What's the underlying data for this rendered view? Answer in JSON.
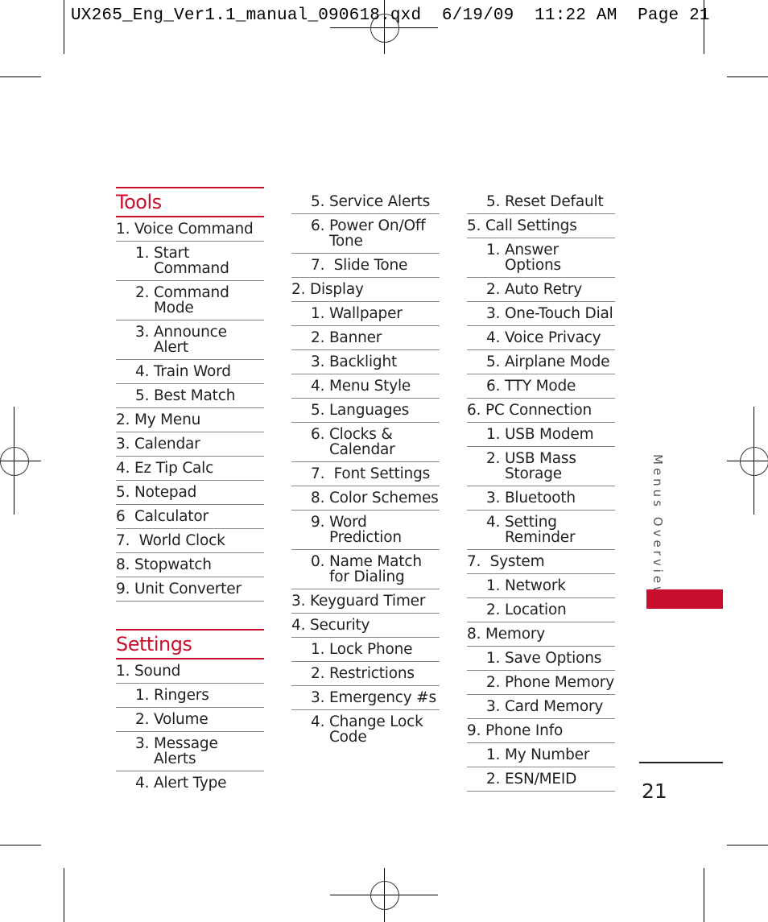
{
  "slug_line": "UX265_Eng_Ver1.1_manual_090618.qxd  6/19/09  11:22 AM  Page 21",
  "colors": {
    "accent": "#c8102e",
    "text": "#231f20",
    "rule": "#888888"
  },
  "column1": {
    "tools": {
      "title": "Tools",
      "items": [
        {
          "n": "1. ",
          "t": "Voice Command",
          "level": 0
        },
        {
          "n": "1. ",
          "t": "Start Command",
          "level": 1
        },
        {
          "n": "2. ",
          "t": "Command Mode",
          "level": 1
        },
        {
          "n": "3. ",
          "t": "Announce Alert",
          "level": 1
        },
        {
          "n": "4. ",
          "t": "Train Word",
          "level": 1
        },
        {
          "n": "5. ",
          "t": "Best Match",
          "level": 1
        },
        {
          "n": "2. ",
          "t": "My Menu",
          "level": 0
        },
        {
          "n": "3. ",
          "t": "Calendar",
          "level": 0
        },
        {
          "n": "4. ",
          "t": "Ez Tip Calc",
          "level": 0
        },
        {
          "n": "5. ",
          "t": "Notepad",
          "level": 0
        },
        {
          "n": "6  ",
          "t": "Calculator",
          "level": 0
        },
        {
          "n": "7.  ",
          "t": "World Clock",
          "level": 0
        },
        {
          "n": "8. ",
          "t": "Stopwatch",
          "level": 0
        },
        {
          "n": "9. ",
          "t": "Unit Converter",
          "level": 0
        }
      ]
    },
    "settings": {
      "title": "Settings",
      "items": [
        {
          "n": "1. ",
          "t": "Sound",
          "level": 0
        },
        {
          "n": "1. ",
          "t": "Ringers",
          "level": 1
        },
        {
          "n": "2. ",
          "t": "Volume",
          "level": 1
        },
        {
          "n": "3. ",
          "t": "Message Alerts",
          "level": 1
        },
        {
          "n": "4. ",
          "t": "Alert Type",
          "level": 1
        }
      ]
    }
  },
  "column2": {
    "items": [
      {
        "n": "5. ",
        "t": "Service Alerts",
        "level": 1
      },
      {
        "n": "6. ",
        "t": "Power On/Off Tone",
        "level": 1
      },
      {
        "n": "7.  ",
        "t": "Slide Tone",
        "level": 1
      },
      {
        "n": "2. ",
        "t": "Display",
        "level": 0
      },
      {
        "n": "1. ",
        "t": "Wallpaper",
        "level": 1
      },
      {
        "n": "2. ",
        "t": "Banner",
        "level": 1
      },
      {
        "n": "3. ",
        "t": "Backlight",
        "level": 1
      },
      {
        "n": "4. ",
        "t": "Menu Style",
        "level": 1
      },
      {
        "n": "5. ",
        "t": "Languages",
        "level": 1
      },
      {
        "n": "6. ",
        "t": "Clocks & Calendar",
        "level": 1
      },
      {
        "n": "7.  ",
        "t": "Font Settings",
        "level": 1
      },
      {
        "n": "8. ",
        "t": "Color Schemes",
        "level": 1
      },
      {
        "n": "9. ",
        "t": "Word Prediction",
        "level": 1
      },
      {
        "n": "0. ",
        "t": "Name Match for Dialing",
        "level": 1
      },
      {
        "n": "3. ",
        "t": "Keyguard Timer",
        "level": 0
      },
      {
        "n": "4. ",
        "t": "Security",
        "level": 0
      },
      {
        "n": "1. ",
        "t": "Lock Phone",
        "level": 1
      },
      {
        "n": "2. ",
        "t": "Restrictions",
        "level": 1
      },
      {
        "n": "3. ",
        "t": "Emergency #s",
        "level": 1
      },
      {
        "n": "4. ",
        "t": "Change Lock Code",
        "level": 1
      }
    ]
  },
  "column3": {
    "items": [
      {
        "n": "5. ",
        "t": "Reset Default",
        "level": 1
      },
      {
        "n": "5. ",
        "t": "Call Settings",
        "level": 0
      },
      {
        "n": "1. ",
        "t": "Answer Options",
        "level": 1
      },
      {
        "n": "2. ",
        "t": "Auto Retry",
        "level": 1
      },
      {
        "n": "3. ",
        "t": "One-Touch Dial",
        "level": 1
      },
      {
        "n": "4. ",
        "t": "Voice Privacy",
        "level": 1
      },
      {
        "n": "5. ",
        "t": "Airplane Mode",
        "level": 1
      },
      {
        "n": "6. ",
        "t": "TTY Mode",
        "level": 1
      },
      {
        "n": "6. ",
        "t": "PC Connection",
        "level": 0
      },
      {
        "n": "1. ",
        "t": "USB Modem",
        "level": 1
      },
      {
        "n": "2. ",
        "t": "USB Mass Storage",
        "level": 1
      },
      {
        "n": "3. ",
        "t": "Bluetooth",
        "level": 1
      },
      {
        "n": "4. ",
        "t": "Setting Reminder",
        "level": 1
      },
      {
        "n": "7.  ",
        "t": "System",
        "level": 0
      },
      {
        "n": "1. ",
        "t": "Network",
        "level": 1
      },
      {
        "n": "2. ",
        "t": "Location",
        "level": 1
      },
      {
        "n": "8. ",
        "t": "Memory",
        "level": 0
      },
      {
        "n": "1. ",
        "t": "Save Options",
        "level": 1
      },
      {
        "n": "2. ",
        "t": "Phone Memory",
        "level": 1
      },
      {
        "n": "3. ",
        "t": "Card Memory",
        "level": 1
      },
      {
        "n": "9. ",
        "t": "Phone Info",
        "level": 0
      },
      {
        "n": "1. ",
        "t": "My Number",
        "level": 1
      },
      {
        "n": "2. ",
        "t": "ESN/MEID",
        "level": 1
      }
    ]
  },
  "side_label": "Menus Overview",
  "page_number": "21"
}
